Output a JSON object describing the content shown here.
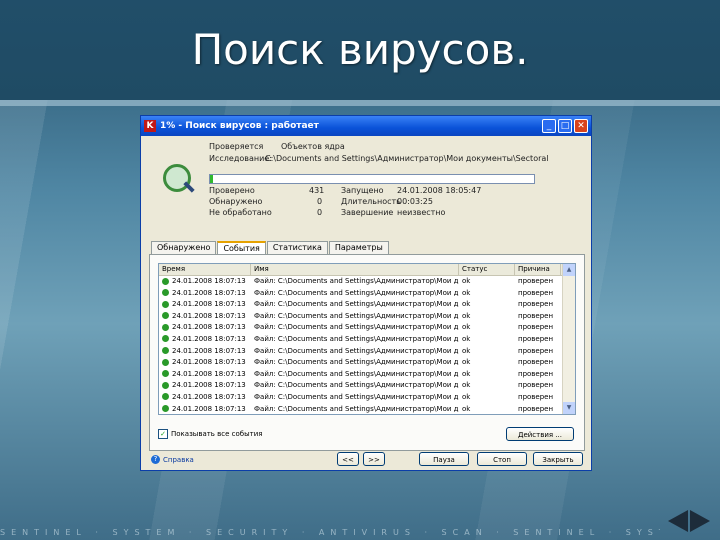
{
  "slide": {
    "title": "Поиск вирусов.",
    "bottom_strip": "SENTINEL · SYSTEM · SECURITY · ANTIVIRUS · SCAN · SENTINEL · SYSTEM · SECURITY"
  },
  "window": {
    "title": "1% - Поиск вирусов : работает",
    "stats_top": {
      "checked_label": "Проверяется",
      "checked_value": "Объектов ядра",
      "current_label": "Исследование:",
      "current_value": "C:\\Documents and Settings\\Администратор\\Мои документы\\Sectoral"
    },
    "progress_percent": 1,
    "stats_left": [
      {
        "label": "Проверено",
        "value": "431"
      },
      {
        "label": "Обнаружено",
        "value": "0"
      },
      {
        "label": "Не обработано",
        "value": "0"
      }
    ],
    "stats_right": [
      {
        "label": "Запущено",
        "value": "24.01.2008 18:05:47"
      },
      {
        "label": "Длительность",
        "value": "00:03:25"
      },
      {
        "label": "Завершение",
        "value": "неизвестно"
      }
    ],
    "tabs": [
      "Обнаружено",
      "События",
      "Статистика",
      "Параметры"
    ],
    "active_tab": "События",
    "table": {
      "headers": [
        "Время",
        "Имя",
        "Статус",
        "Причина"
      ],
      "rows": [
        {
          "time": "24.01.2008 18:07:13",
          "name": "Файл: C:\\Documents and Settings\\Администратор\\Мои д...",
          "status": "ok",
          "reason": "проверен"
        },
        {
          "time": "24.01.2008 18:07:13",
          "name": "Файл: C:\\Documents and Settings\\Администратор\\Мои д...",
          "status": "ok",
          "reason": "проверен"
        },
        {
          "time": "24.01.2008 18:07:13",
          "name": "Файл: C:\\Documents and Settings\\Администратор\\Мои д...",
          "status": "ok",
          "reason": "проверен"
        },
        {
          "time": "24.01.2008 18:07:13",
          "name": "Файл: C:\\Documents and Settings\\Администратор\\Мои д...",
          "status": "ok",
          "reason": "проверен"
        },
        {
          "time": "24.01.2008 18:07:13",
          "name": "Файл: C:\\Documents and Settings\\Администратор\\Мои д...",
          "status": "ok",
          "reason": "проверен"
        },
        {
          "time": "24.01.2008 18:07:13",
          "name": "Файл: C:\\Documents and Settings\\Администратор\\Мои д...",
          "status": "ok",
          "reason": "проверен"
        },
        {
          "time": "24.01.2008 18:07:13",
          "name": "Файл: C:\\Documents and Settings\\Администратор\\Мои д...",
          "status": "ok",
          "reason": "проверен"
        },
        {
          "time": "24.01.2008 18:07:13",
          "name": "Файл: C:\\Documents and Settings\\Администратор\\Мои д...",
          "status": "ok",
          "reason": "проверен"
        },
        {
          "time": "24.01.2008 18:07:13",
          "name": "Файл: C:\\Documents and Settings\\Администратор\\Мои д...",
          "status": "ok",
          "reason": "проверен"
        },
        {
          "time": "24.01.2008 18:07:13",
          "name": "Файл: C:\\Documents and Settings\\Администратор\\Мои д...",
          "status": "ok",
          "reason": "проверен"
        },
        {
          "time": "24.01.2008 18:07:13",
          "name": "Файл: C:\\Documents and Settings\\Администратор\\Мои д...",
          "status": "ok",
          "reason": "проверен"
        },
        {
          "time": "24.01.2008 18:07:13",
          "name": "Файл: C:\\Documents and Settings\\Администратор\\Мои д...",
          "status": "ok",
          "reason": "проверен"
        }
      ]
    },
    "show_all_events_label": "Показывать все события",
    "details_button": "Действия ...",
    "help_label": "Справка",
    "prev_button": "<<",
    "next_button": ">>",
    "pause_button": "Пауза",
    "stop_button": "Стоп",
    "close_button": "Закрыть",
    "colors": {
      "titlebar": "#0a52d8",
      "progress": "#2fb82f",
      "ok": "#2a9a2a"
    }
  }
}
